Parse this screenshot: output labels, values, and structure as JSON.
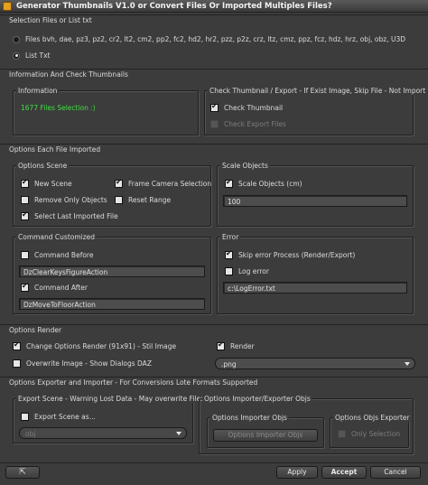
{
  "window": {
    "title": "Generator Thumbnails V1.0 or Convert Files Or Imported Multiples Files?"
  },
  "selection": {
    "header": "Selection Files or List txt",
    "files_label": "Files bvh, dae, pz3, pz2, cr2, lt2, cm2, pp2, fc2, hd2, hr2, pzz, p2z, crz, ltz, cmz, ppz, fcz, hdz, hrz, obj, obz, U3D",
    "list_label": "List Txt"
  },
  "info_check": {
    "header": "Information And Check Thumbnails",
    "information_title": "Information",
    "information_text": "1677 Files Selection :)",
    "check_title": "Check Thumbnail / Export - If Exist Image, Skip File - Not Import File",
    "check_thumbnail": "Check Thumbnail",
    "check_export": "Check Export Files"
  },
  "options_each": {
    "header": "Options Each File Imported",
    "scene_title": "Options Scene",
    "new_scene": "New Scene",
    "frame_camera": "Frame Camera Selection",
    "remove_only_objects": "Remove Only Objects",
    "reset_range": "Reset Range",
    "select_last": "Select Last Imported File",
    "scale_title": "Scale Objects",
    "scale_label": "Scale Objects (cm)",
    "scale_value": "100",
    "command_title": "Command Customized",
    "command_before": "Command Before",
    "command_before_value": "DzClearKeysFigureAction",
    "command_after": "Command After",
    "command_after_value": "DzMoveToFloorAction",
    "error_title": "Error",
    "skip_error": "Skip error Process (Render/Export)",
    "log_error": "Log error",
    "log_path": "c:\\LogError.txt"
  },
  "render": {
    "header": "Options Render",
    "change_options": "Change Options Render (91x91) - Stil Image",
    "render_label": "Render",
    "overwrite": "Overwrite Image - Show Dialogs DAZ",
    "format": ".png"
  },
  "exporter": {
    "header": "Options Exporter and Importer - For Conversions Lote Formats Supported",
    "export_title": "Export Scene - Warning Lost Data - May overwrite Files",
    "export_scene_as": "Export Scene as...",
    "export_format": "obj",
    "importer_exporter_title": "Options Importer/Exporter Objs",
    "importer_title": "Options Importer Objs",
    "importer_button": "Options Importer Objs",
    "exporter_title": "Options Objs Exporter",
    "only_selection": "Only Selection"
  },
  "footer": {
    "help_icon": "help-pointer-icon",
    "apply": "Apply",
    "accept": "Accept",
    "cancel": "Cancel"
  }
}
